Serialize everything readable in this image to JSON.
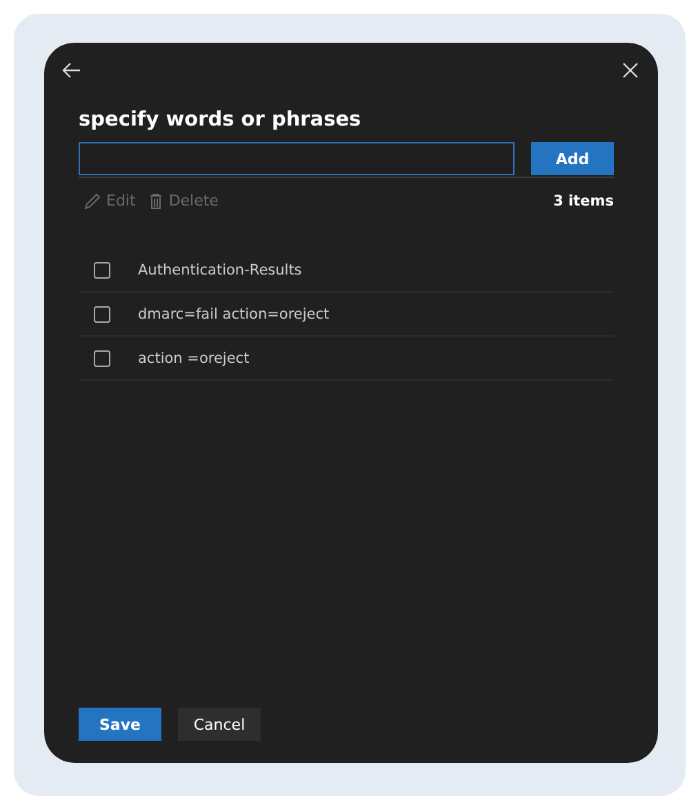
{
  "dialog": {
    "title": "specify words or phrases"
  },
  "add_button": "Add",
  "toolbar": {
    "actions": [
      {
        "kind": "edit",
        "label": "Edit",
        "disabled": true
      },
      {
        "kind": "delete",
        "label": "Delete",
        "disabled": true
      }
    ],
    "count": "3 items"
  },
  "items": [
    {
      "text": "Authentication-Results",
      "checked": false
    },
    {
      "text": "dmarc=fail action=oreject",
      "checked": false
    },
    {
      "text": "action =oreject",
      "checked": false
    }
  ],
  "buttons": [
    {
      "label": "Save",
      "kind": "primary"
    },
    {
      "label": "Cancel",
      "kind": "secondary"
    }
  ]
}
